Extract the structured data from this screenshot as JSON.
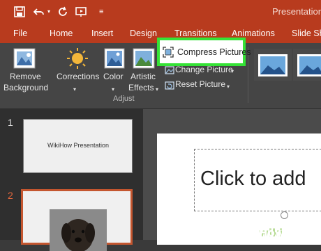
{
  "window": {
    "filename": "Presentation.p"
  },
  "quick_access": {
    "icons": [
      "save-icon",
      "undo-icon",
      "redo-icon",
      "present-icon",
      "customize-icon"
    ]
  },
  "tabs": [
    {
      "label": "File"
    },
    {
      "label": "Home"
    },
    {
      "label": "Insert"
    },
    {
      "label": "Design"
    },
    {
      "label": "Transitions"
    },
    {
      "label": "Animations"
    },
    {
      "label": "Slide Sh"
    }
  ],
  "ribbon": {
    "remove_background": {
      "line1": "Remove",
      "line2": "Background"
    },
    "corrections": {
      "label": "Corrections"
    },
    "color": {
      "label": "Color"
    },
    "artistic_effects": {
      "line1": "Artistic",
      "line2": "Effects"
    },
    "compress_pictures": {
      "label": "Compress Pictures"
    },
    "change_picture": {
      "label": "Change Picture"
    },
    "reset_picture": {
      "label": "Reset Picture"
    },
    "group_label": "Adjust"
  },
  "slides": [
    {
      "number": "1",
      "title": "WikiHow Presentation"
    },
    {
      "number": "2"
    }
  ],
  "editor": {
    "placeholder": "Click to add"
  },
  "watermark": {
    "prefix": "wiki",
    "suffix": "How"
  },
  "colors": {
    "titlebar": "#b83b1e",
    "highlight": "#35e236",
    "selected_slide": "#c4562f"
  }
}
